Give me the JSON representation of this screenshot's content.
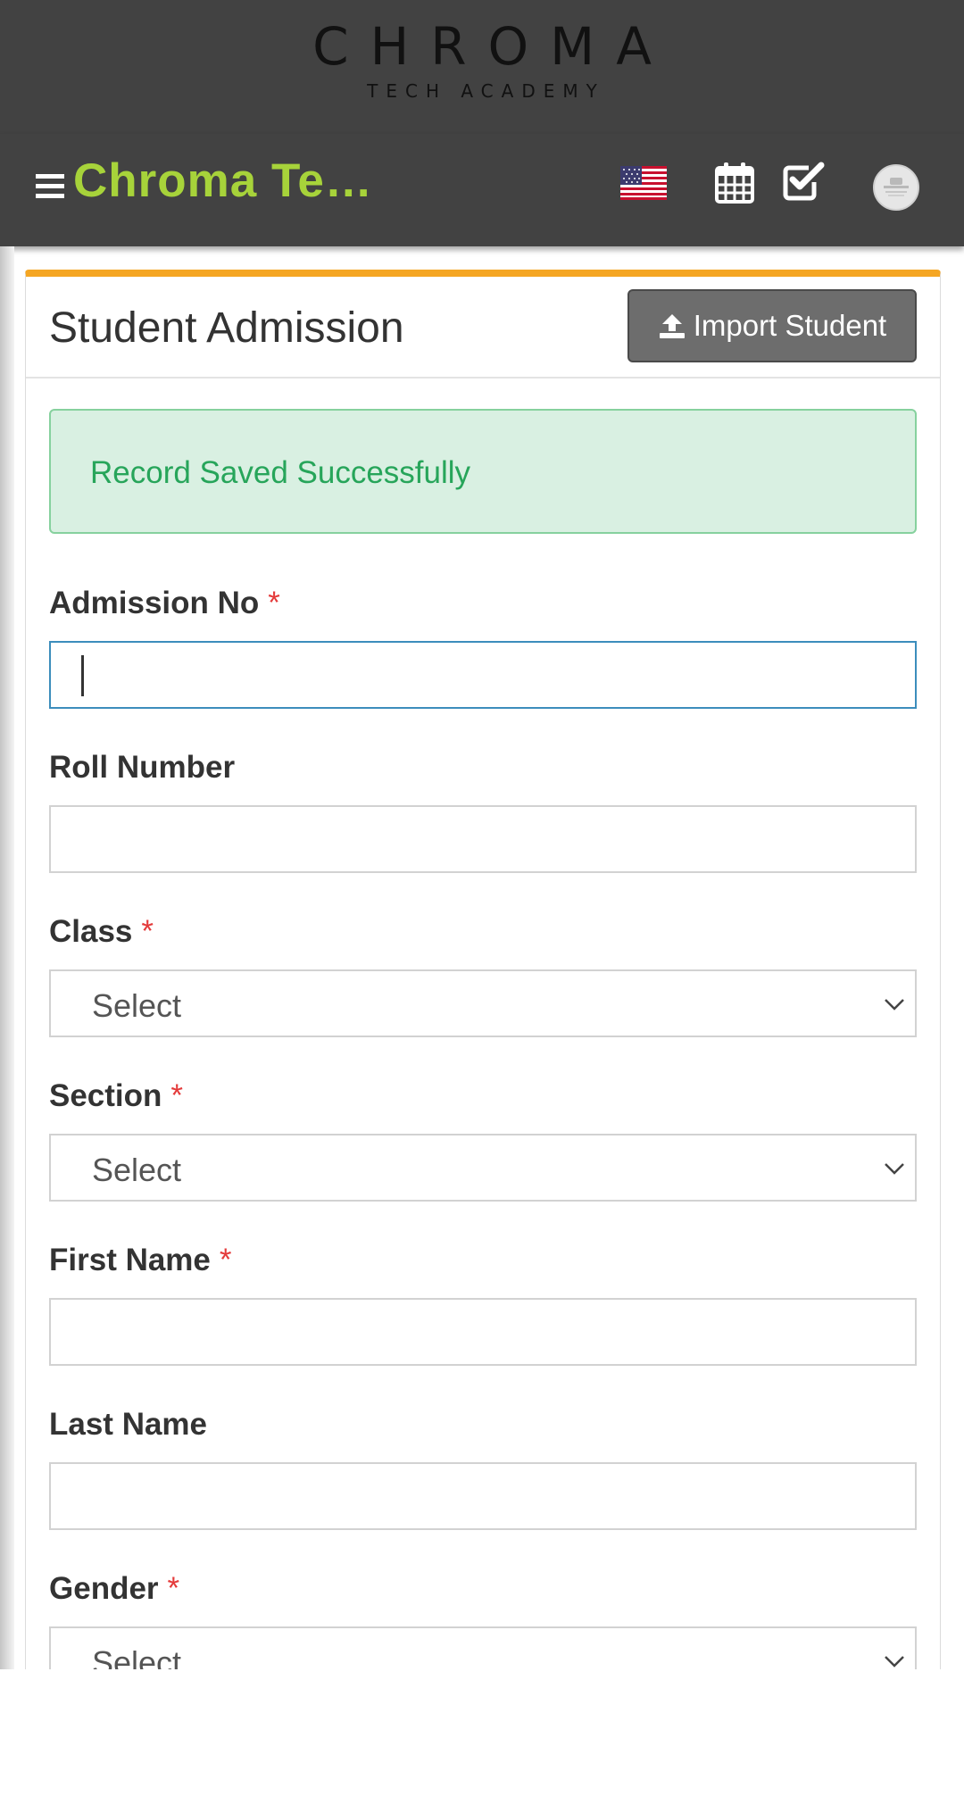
{
  "logo": {
    "main": "CHROMA",
    "sub": "TECH ACADEMY"
  },
  "navbar": {
    "brand": "Chroma Te…",
    "icons": [
      "menu-icon",
      "us-flag-icon",
      "calendar-icon",
      "check-square-icon",
      "avatar-no-image-icon"
    ]
  },
  "colors": {
    "brand": "#a7d33a",
    "card_accent": "#f5a623",
    "success_text": "#27a55a",
    "success_bg": "#d9f0e2",
    "required": "#e43b3b"
  },
  "page": {
    "title": "Student Admission",
    "import_button": "Import Student"
  },
  "alert": {
    "message": "Record Saved Successfully"
  },
  "form": {
    "admission_no": {
      "label": "Admission No",
      "required": "*",
      "value": ""
    },
    "roll_number": {
      "label": "Roll Number",
      "value": ""
    },
    "class": {
      "label": "Class",
      "required": "*",
      "selected": "Select"
    },
    "section": {
      "label": "Section",
      "required": "*",
      "selected": "Select"
    },
    "first_name": {
      "label": "First Name",
      "required": "*",
      "value": ""
    },
    "last_name": {
      "label": "Last Name",
      "value": ""
    },
    "gender": {
      "label": "Gender",
      "required": "*",
      "selected": "Select"
    }
  }
}
